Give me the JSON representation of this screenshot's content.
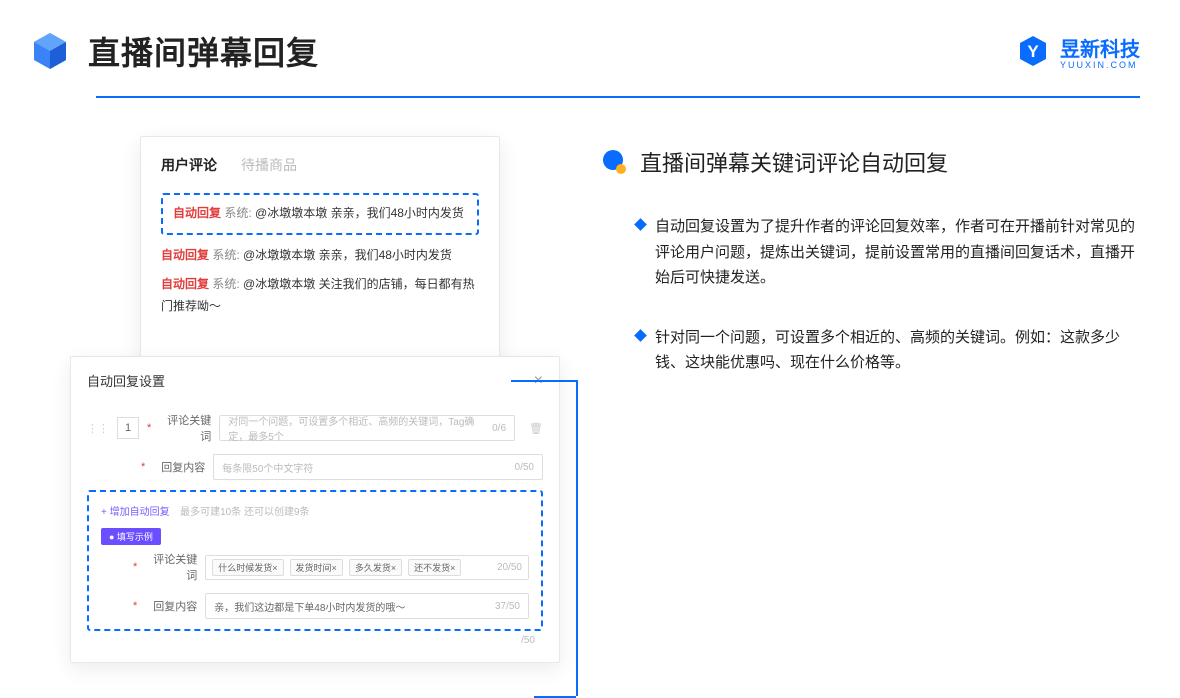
{
  "header": {
    "title": "直播间弹幕回复",
    "brand": "昱新科技",
    "brand_sub": "YUUXIN.COM"
  },
  "tabs": {
    "active": "用户评论",
    "inactive": "待播商品"
  },
  "comments": {
    "highlighted": {
      "tag": "自动回复",
      "sys": "系统:",
      "text": "@冰墩墩本墩 亲亲，我们48小时内发货"
    },
    "item2": {
      "tag": "自动回复",
      "sys": "系统:",
      "text": "@冰墩墩本墩 亲亲，我们48小时内发货"
    },
    "item3": {
      "tag": "自动回复",
      "sys": "系统:",
      "text": "@冰墩墩本墩 关注我们的店铺，每日都有热门推荐呦～"
    }
  },
  "settings": {
    "title": "自动回复设置",
    "idx": "1",
    "label_keyword": "评论关键词",
    "placeholder_keyword": "对同一个问题，可设置多个相近、高频的关键词，Tag确定，最多5个",
    "counter_keyword": "0/6",
    "label_content": "回复内容",
    "placeholder_content": "每条限50个中文字符",
    "counter_content": "0/50",
    "add_link": "+ 增加自动回复",
    "add_hint": "最多可建10条 还可以创建9条",
    "example_badge": "● 填写示例",
    "ex_label_keyword": "评论关键词",
    "ex_tags": [
      "什么时候发货×",
      "发货时间×",
      "多久发货×",
      "还不发货×"
    ],
    "ex_counter_keyword": "20/50",
    "ex_label_content": "回复内容",
    "ex_content": "亲，我们这边都是下单48小时内发货的哦～",
    "ex_counter_content": "37/50",
    "outer_counter": "/50"
  },
  "right": {
    "title": "直播间弹幕关键词评论自动回复",
    "point1": "自动回复设置为了提升作者的评论回复效率，作者可在开播前针对常见的评论用户问题，提炼出关键词，提前设置常用的直播间回复话术，直播开始后可快捷发送。",
    "point2": "针对同一个问题，可设置多个相近的、高频的关键词。例如：这款多少钱、这块能优惠吗、现在什么价格等。"
  }
}
